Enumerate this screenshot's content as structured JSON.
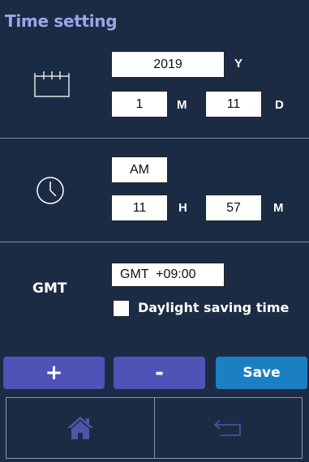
{
  "header": {
    "title": "Time setting"
  },
  "date": {
    "year": "2019",
    "year_unit": "Y",
    "month": "1",
    "month_unit": "M",
    "day": "11",
    "day_unit": "D"
  },
  "time": {
    "ampm": "AM",
    "hour": "11",
    "hour_unit": "H",
    "minute": "57",
    "minute_unit": "M"
  },
  "gmt": {
    "label": "GMT",
    "value": "GMT  +09:00",
    "dst_label": "Daylight saving time"
  },
  "buttons": {
    "plus": "+",
    "minus": "-",
    "save": "Save"
  },
  "colors": {
    "background": "#1c2b44",
    "title": "#9aa6ea",
    "button_primary": "#5152b8",
    "button_save": "#1b7fc4",
    "home_icon": "#4a57a8"
  },
  "icons": {
    "date": "calendar-icon",
    "time": "clock-icon",
    "home": "home-icon",
    "back": "back-arrow-icon"
  }
}
